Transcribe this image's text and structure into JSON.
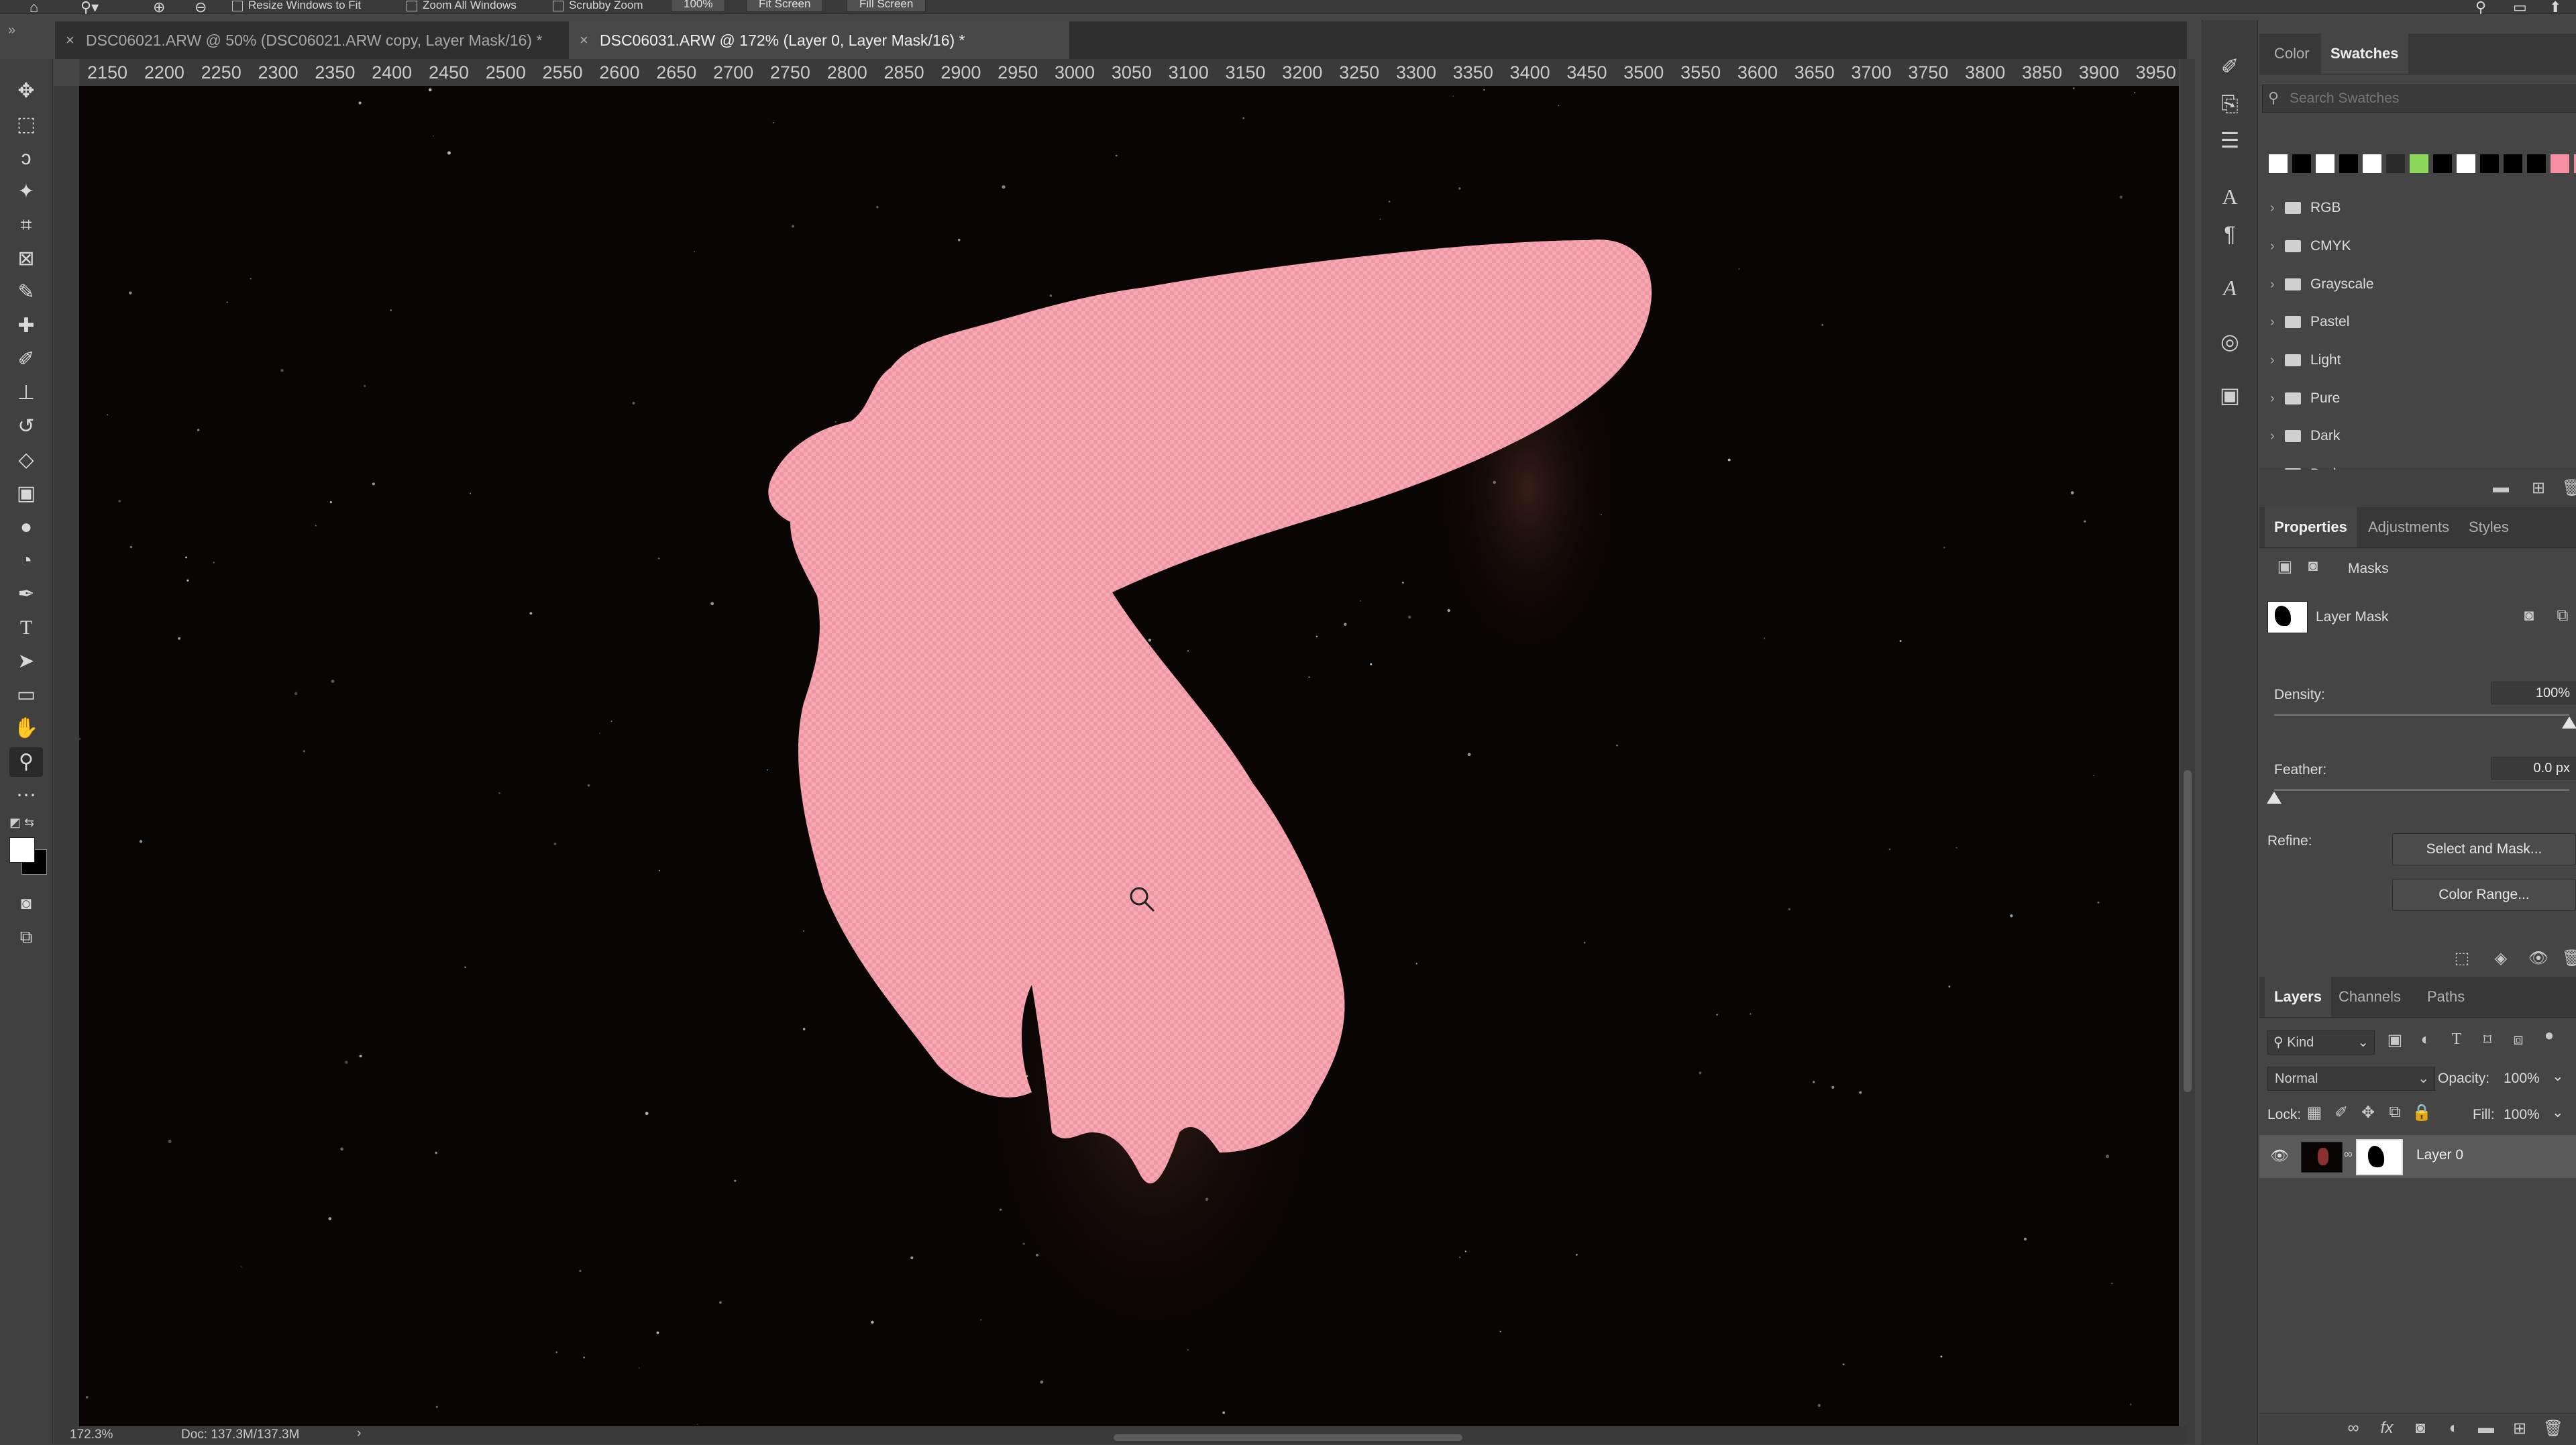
{
  "options_bar": {
    "resize_windows": "Resize Windows to Fit",
    "zoom_all": "Zoom All Windows",
    "scrubby_zoom": "Scrubby Zoom",
    "zoom_value": "100%",
    "fit_screen": "Fit Screen",
    "fill_screen": "Fill Screen"
  },
  "tabs": [
    {
      "label": "DSC06021.ARW @ 50% (DSC06021.ARW copy, Layer Mask/16) *",
      "active": false
    },
    {
      "label": "DSC06031.ARW @ 172% (Layer 0, Layer Mask/16) *",
      "active": true
    }
  ],
  "ruler": {
    "ticks": [
      "2150",
      "2200",
      "2250",
      "2300",
      "2350",
      "2400",
      "2450",
      "2500",
      "2550",
      "2600",
      "2650",
      "2700",
      "2750",
      "2800",
      "2850",
      "2900",
      "2950",
      "3000",
      "3050",
      "3100",
      "3150",
      "3200",
      "3250",
      "3300",
      "3350",
      "3400",
      "3450",
      "3500",
      "3550",
      "3600",
      "3650",
      "3700",
      "3750",
      "3800",
      "3850",
      "3900",
      "3950"
    ]
  },
  "status": {
    "zoom": "172.3%",
    "doc": "Doc: 137.3M/137.3M"
  },
  "swatches_panel": {
    "tabs": [
      "Color",
      "Swatches"
    ],
    "active_tab": "Swatches",
    "search_placeholder": "Search Swatches",
    "colors": [
      "#ffffff",
      "#000000",
      "#ffffff",
      "#000000",
      "#ffffff",
      "#2a2a2a",
      "#8cd85a",
      "#000000",
      "#ffffff",
      "#000000",
      "#000000",
      "#000000",
      "#f48fa4",
      "#f48fa4",
      "#c0506a"
    ],
    "groups": [
      "RGB",
      "CMYK",
      "Grayscale",
      "Pastel",
      "Light",
      "Pure",
      "Dark",
      "Darker"
    ]
  },
  "properties_panel": {
    "tabs": [
      "Properties",
      "Adjustments",
      "Styles"
    ],
    "active_tab": "Properties",
    "section": "Masks",
    "mask_label": "Layer Mask",
    "density_label": "Density:",
    "density_value": "100%",
    "density_fraction": 1.0,
    "feather_label": "Feather:",
    "feather_value": "0.0 px",
    "feather_fraction": 0.0,
    "refine_label": "Refine:",
    "select_mask": "Select and Mask...",
    "color_range": "Color Range..."
  },
  "layers_panel": {
    "tabs": [
      "Layers",
      "Channels",
      "Paths"
    ],
    "active_tab": "Layers",
    "filter_kind": "Kind",
    "blend_mode": "Normal",
    "opacity_label": "Opacity:",
    "opacity_value": "100%",
    "lock_label": "Lock:",
    "fill_label": "Fill:",
    "fill_value": "100%",
    "layers": [
      {
        "name": "Layer 0",
        "visible": true
      }
    ]
  },
  "colors": {
    "mask_overlay": "#f5a3ae",
    "canvas_bg": "#0a0505",
    "accent": "#f48fa4"
  },
  "icons": {
    "tools": [
      "move-icon",
      "marquee-icon",
      "lasso-icon",
      "magic-wand-icon",
      "crop-icon",
      "frame-icon",
      "eyedropper-icon",
      "healing-brush-icon",
      "brush-icon",
      "clone-stamp-icon",
      "history-brush-icon",
      "eraser-icon",
      "gradient-icon",
      "blur-icon",
      "dodge-icon",
      "pen-icon",
      "type-icon",
      "path-select-icon",
      "rectangle-icon",
      "hand-icon",
      "zoom-icon",
      "more-tools-icon"
    ]
  }
}
